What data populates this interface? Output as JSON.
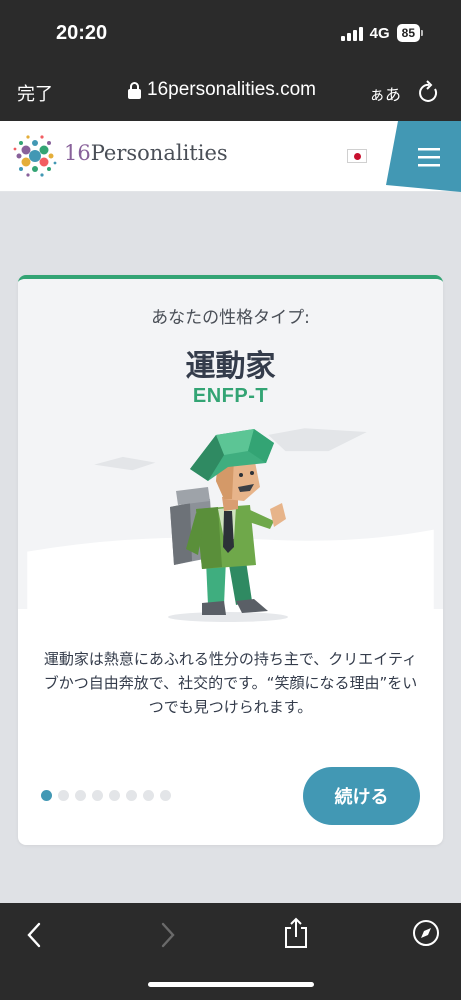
{
  "status_bar": {
    "time": "20:20",
    "network": "4G",
    "battery": "85"
  },
  "browser": {
    "done_label": "完了",
    "url": "16personalities.com",
    "text_size_label": "ぁあ"
  },
  "site": {
    "logo_number": "16",
    "logo_word": "Personalities",
    "colors": {
      "brand_green": "#33a474",
      "accent_blue": "#4298b4",
      "menu_bg": "#4298b4"
    }
  },
  "card": {
    "your_type_label": "あなたの性格タイプ:",
    "type_name": "運動家",
    "type_code": "ENFP-T",
    "description": "運動家は熱意にあふれる性分の持ち主で、クリエイティブかつ自由奔放で、社交的です。“笑顔になる理由”をいつでも見つけられます。",
    "pager": {
      "total": 8,
      "current": 1
    },
    "continue_label": "続ける"
  }
}
